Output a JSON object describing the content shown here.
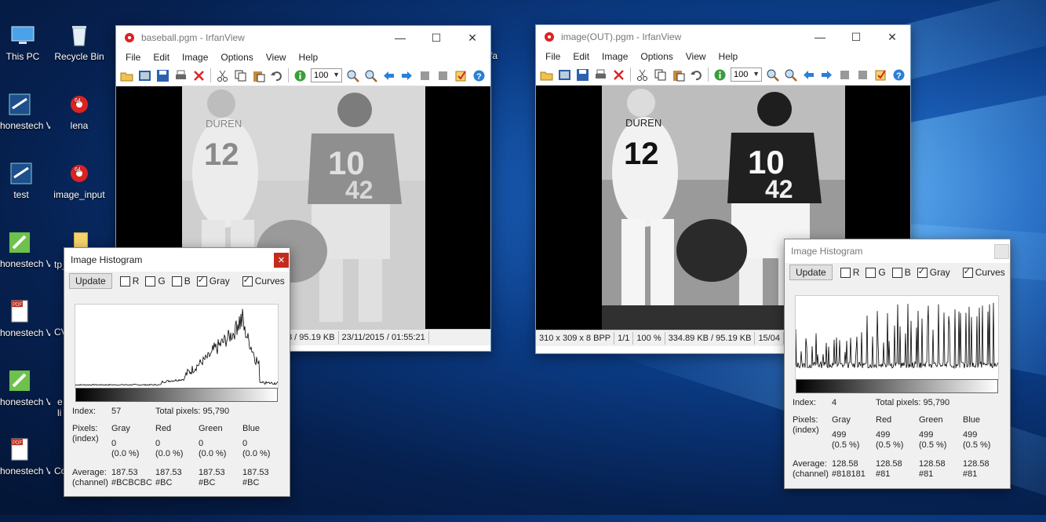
{
  "desktop": {
    "icons": [
      {
        "label": "This PC",
        "x": "col1"
      },
      {
        "label": "Recycle Bin"
      },
      {
        "label": "honestech VHS to D..."
      },
      {
        "label": "lena"
      },
      {
        "label": "test"
      },
      {
        "label": "image_input"
      },
      {
        "label": "honestech VHS to D..."
      },
      {
        "label": "honestech VHS to D..."
      },
      {
        "label": "honestech VHS to D..."
      },
      {
        "label": "honestech VHS to D..."
      }
    ],
    "partial_labels": [
      "tp_",
      "CV",
      "e",
      "li",
      "Co",
      "fa"
    ]
  },
  "window1": {
    "title": "baseball.pgm - IrfanView",
    "menu": [
      "File",
      "Edit",
      "Image",
      "Options",
      "View",
      "Help"
    ],
    "zoom": "100",
    "status": [
      "3 / 95.19 KB",
      "23/11/2015 / 01:55:21"
    ]
  },
  "window2": {
    "title": "image(OUT).pgm - IrfanView",
    "menu": [
      "File",
      "Edit",
      "Image",
      "Options",
      "View",
      "Help"
    ],
    "zoom": "100",
    "status": [
      "310 x 309 x 8 BPP",
      "1/1",
      "100 %",
      "334.89 KB / 95.19 KB",
      "15/04"
    ]
  },
  "hist1": {
    "title": "Image Histogram",
    "update": "Update",
    "checks": [
      {
        "label": "R",
        "on": false
      },
      {
        "label": "G",
        "on": false
      },
      {
        "label": "B",
        "on": false
      },
      {
        "label": "Gray",
        "on": true
      },
      {
        "label": "Curves",
        "on": true
      }
    ],
    "index_label": "Index:",
    "index": "57",
    "total_label": "Total pixels: 95,790",
    "pixels_label": "Pixels:",
    "pixels_sub": "(index)",
    "cols": [
      "Gray",
      "Red",
      "Green",
      "Blue"
    ],
    "pix_vals": [
      "0",
      "0",
      "0",
      "0"
    ],
    "pix_pct": [
      "(0.0 %)",
      "(0.0 %)",
      "(0.0 %)",
      "(0.0 %)"
    ],
    "avg_label": "Average:",
    "avg_sub": "(channel)",
    "avg_vals": [
      "187.53",
      "187.53",
      "187.53",
      "187.53"
    ],
    "avg_hex": [
      "#BCBCBC",
      "#BC",
      "#BC",
      "#BC"
    ]
  },
  "hist2": {
    "title": "Image Histogram",
    "update": "Update",
    "checks": [
      {
        "label": "R",
        "on": false
      },
      {
        "label": "G",
        "on": false
      },
      {
        "label": "B",
        "on": false
      },
      {
        "label": "Gray",
        "on": true
      },
      {
        "label": "Curves",
        "on": true
      }
    ],
    "index_label": "Index:",
    "index": "4",
    "total_label": "Total pixels: 95,790",
    "pixels_label": "Pixels:",
    "pixels_sub": "(index)",
    "cols": [
      "Gray",
      "Red",
      "Green",
      "Blue"
    ],
    "pix_vals": [
      "499",
      "499",
      "499",
      "499"
    ],
    "pix_pct": [
      "(0.5 %)",
      "(0.5 %)",
      "(0.5 %)",
      "(0.5 %)"
    ],
    "avg_label": "Average:",
    "avg_sub": "(channel)",
    "avg_vals": [
      "128.58",
      "128.58",
      "128.58",
      "128.58"
    ],
    "avg_hex": [
      "#818181",
      "#81",
      "#81",
      "#81"
    ]
  }
}
